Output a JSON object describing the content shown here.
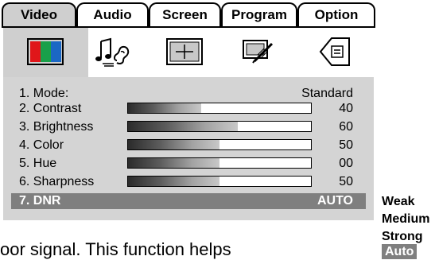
{
  "tabs": [
    {
      "label": "Video",
      "active": true
    },
    {
      "label": "Audio",
      "active": false
    },
    {
      "label": "Screen",
      "active": false
    },
    {
      "label": "Program",
      "active": false
    },
    {
      "label": "Option",
      "active": false
    }
  ],
  "icons": [
    "color-bars-icon",
    "music-ear-icon",
    "screen-crosshair-icon",
    "program-edit-icon",
    "option-tag-icon"
  ],
  "menu": {
    "items": [
      {
        "label": "1. Mode:",
        "value": "Standard"
      },
      {
        "label": "2. Contrast",
        "value": "40",
        "level": 40
      },
      {
        "label": "3. Brightness",
        "value": "60",
        "level": 60
      },
      {
        "label": "4. Color",
        "value": "50",
        "level": 50
      },
      {
        "label": "5. Hue",
        "value": "00",
        "level": 50
      },
      {
        "label": "6. Sharpness",
        "value": "50",
        "level": 50
      },
      {
        "label": "7. DNR",
        "value": "AUTO",
        "selected": true
      }
    ]
  },
  "dnr_options": [
    "Weak",
    "Medium",
    "Strong",
    "Auto"
  ],
  "dnr_selected": "Auto",
  "body_text": "oor signal. This function helps",
  "colors": {
    "panel": "#d4d4d4",
    "highlight": "#7f7f7f",
    "active_tab": "#cfcfcf"
  }
}
